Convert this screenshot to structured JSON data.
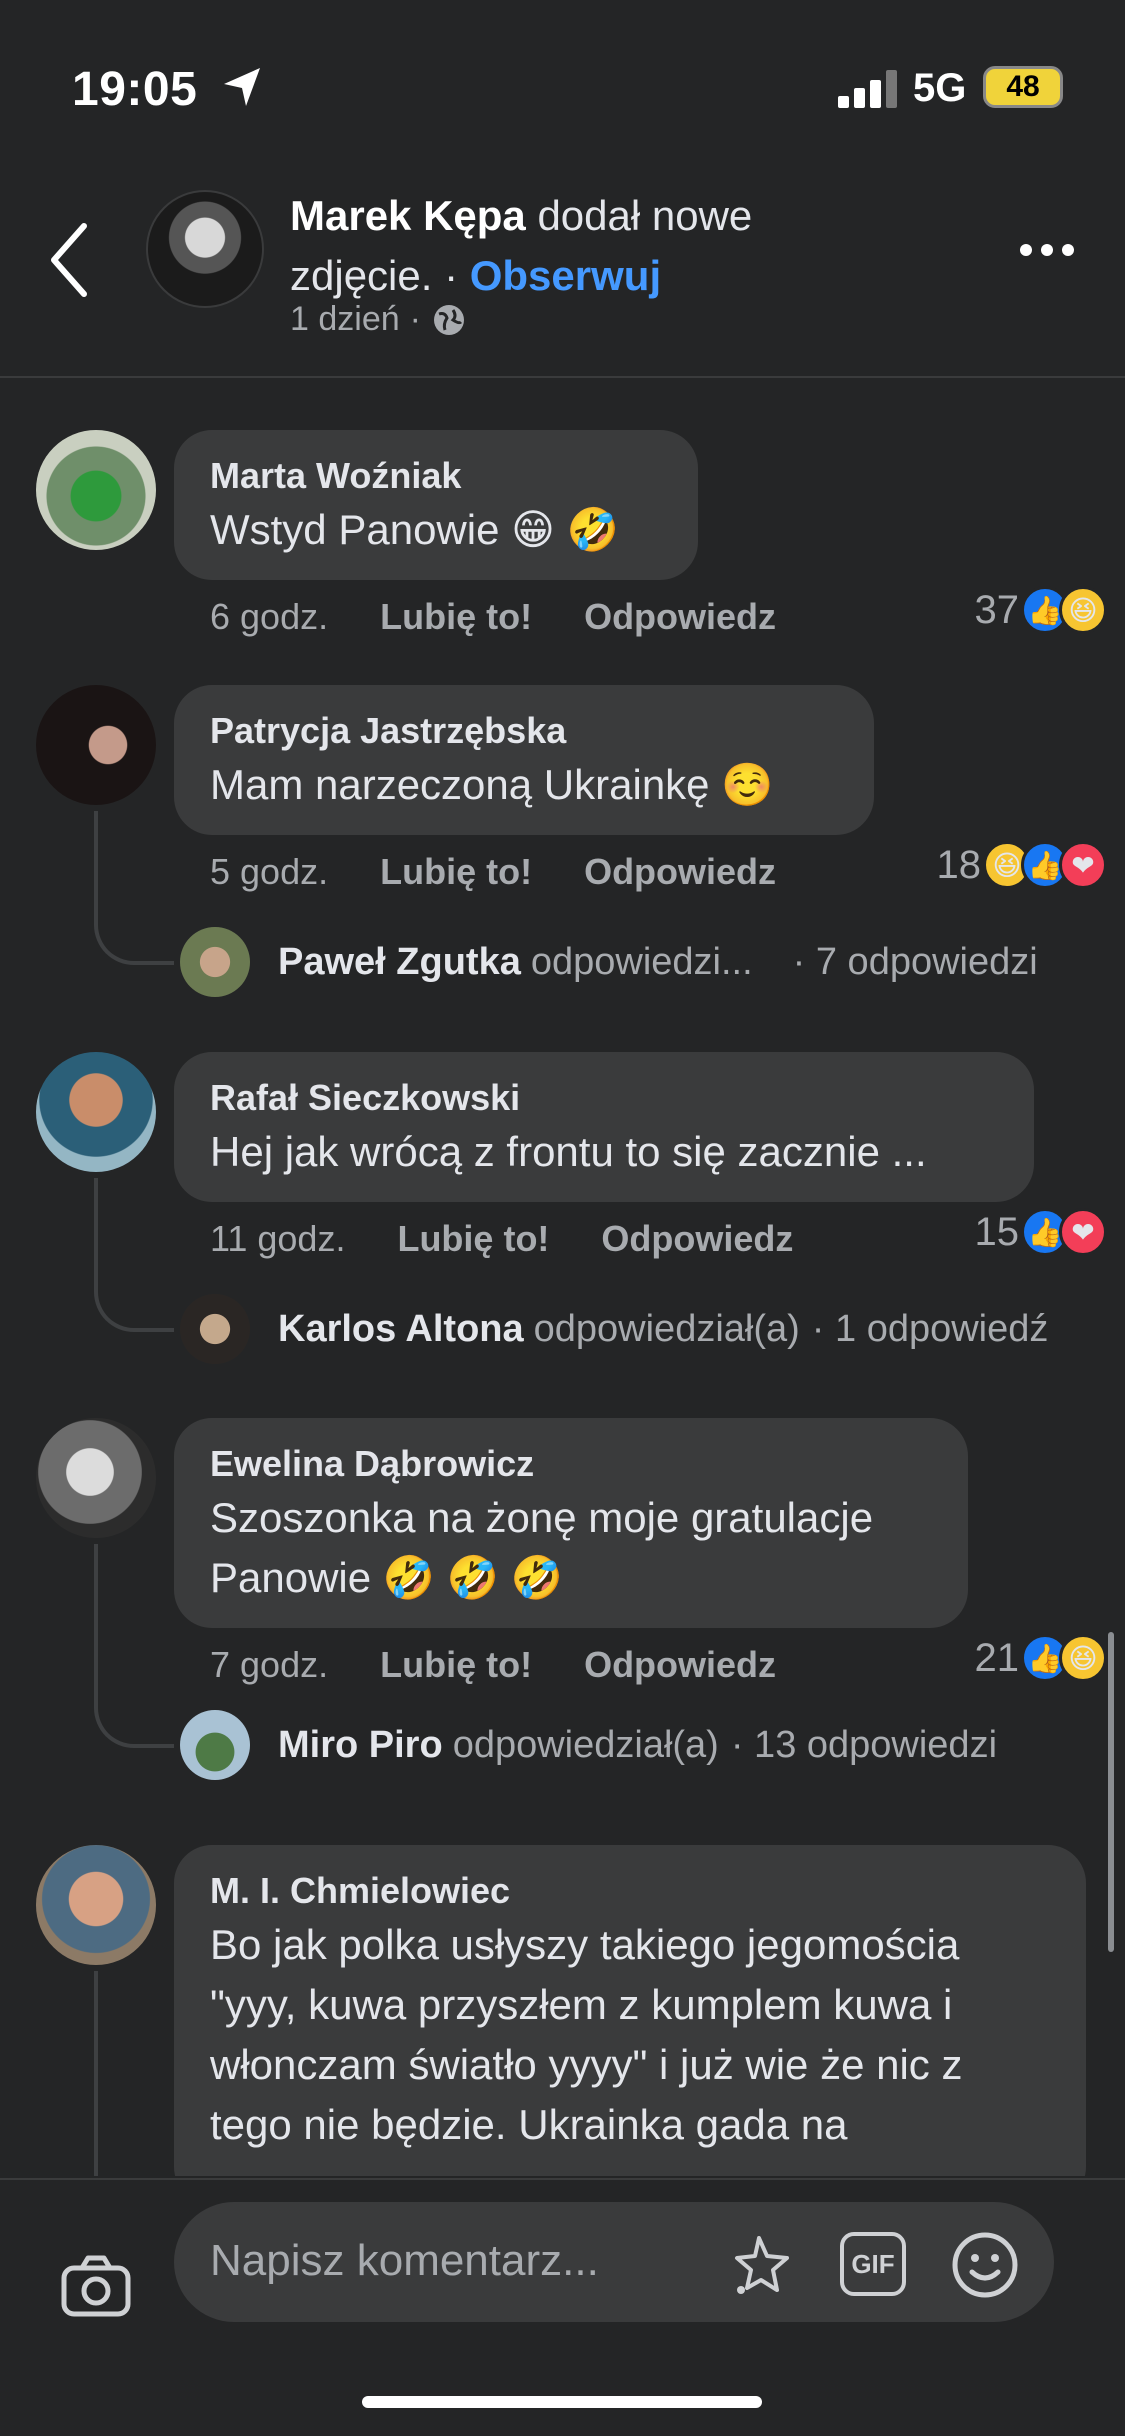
{
  "status_bar": {
    "time": "19:05",
    "network": "5G",
    "battery": "48"
  },
  "header": {
    "author": "Marek Kępa",
    "action": " dodał nowe zdjęcie. · ",
    "follow": "Obserwuj",
    "time": "1 dzień",
    "separator": "·"
  },
  "comments": [
    {
      "name": "Marta Woźniak",
      "text": "Wstyd Panowie 😁 🤣",
      "time": "6 godz.",
      "like": "Lubię to!",
      "reply": "Odpowiedz",
      "reaction_count": "37"
    },
    {
      "name": "Patrycja Jastrzębska",
      "text": "Mam narzeczoną  Ukrainkę ☺️",
      "time": "5 godz.",
      "like": "Lubię to!",
      "reply": "Odpowiedz",
      "reaction_count": "18",
      "reply_preview": {
        "name": "Paweł Zgutka",
        "action": "odpowiedzi...",
        "count": "· 7 odpowiedzi"
      }
    },
    {
      "name": "Rafał Sieczkowski",
      "text": "Hej jak wrócą z frontu to się zacznie ...",
      "time": "11 godz.",
      "like": "Lubię to!",
      "reply": "Odpowiedz",
      "reaction_count": "15",
      "reply_preview": {
        "name": "Karlos Altona",
        "action": "odpowiedział(a)",
        "count": "· 1 odpowiedź"
      }
    },
    {
      "name": "Ewelina Dąbrowicz",
      "text_line1": "Szoszonka na żonę moje gratulacje",
      "text_line2": "Panowie 🤣 🤣 🤣",
      "time": "7 godz.",
      "like": "Lubię to!",
      "reply": "Odpowiedz",
      "reaction_count": "21",
      "reply_preview": {
        "name": "Miro Piro",
        "action": "odpowiedział(a)",
        "count": "· 13 odpowiedzi"
      }
    },
    {
      "name": "M. I. Chmielowiec",
      "lines": [
        "Bo jak polka usłyszy takiego jegomościa",
        "\"yyy, kuwa przyszłem z kumplem kuwa i",
        "włonczam światło yyyy\" i już wie że nic z",
        "tego nie będzie. Ukrainka gada na"
      ]
    }
  ],
  "composer": {
    "placeholder": "Napisz komentarz...",
    "gif": "GIF"
  },
  "icons": [
    "location-arrow-icon",
    "signal-icon",
    "back-chevron-icon",
    "globe-icon",
    "more-dots-icon",
    "like-icon",
    "haha-icon",
    "love-icon",
    "camera-icon",
    "sticker-icon",
    "gif-icon",
    "emoji-icon"
  ],
  "colors": {
    "background": "#242526",
    "bubble": "#3a3b3c",
    "link": "#4599ff",
    "like": "#1877f2",
    "love": "#f33e58",
    "haha": "#f7c531"
  }
}
